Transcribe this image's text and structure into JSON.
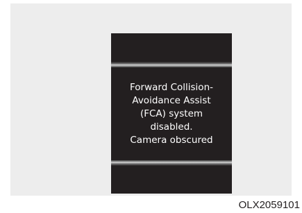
{
  "display": {
    "message_lines": [
      "Forward Collision-",
      "Avoidance Assist",
      "(FCA) system",
      "disabled.",
      "Camera obscured"
    ]
  },
  "figure": {
    "code": "OLX2059101"
  },
  "colors": {
    "panel_background": "#ededed",
    "display_background": "#231f20",
    "message_text": "#ffffff"
  }
}
